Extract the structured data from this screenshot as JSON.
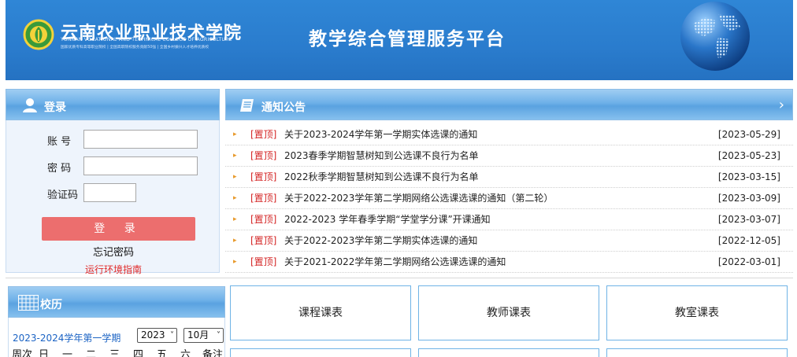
{
  "header": {
    "school_name": "云南农业职业技术学院",
    "school_name_en": "YUNNAN VOCATIONAL AND TECHNICAL COLLEGE OF AGRICULTURE",
    "school_tagline": "国家优质专科高等职业院校 | 全国高职院校服务贡献50强 | 全国乡村振兴人才培养优质校",
    "platform_title": "教学综合管理服务平台"
  },
  "login": {
    "title": "登录",
    "account_label": "账 号",
    "password_label": "密 码",
    "captcha_label": "验证码",
    "account_value": "",
    "password_value": "",
    "captcha_value": "",
    "submit_label": "登 录",
    "forgot_label": "忘记密码",
    "runtime_guide_label": "运行环境指南"
  },
  "notice": {
    "title": "通知公告",
    "items": [
      {
        "tag": "[置顶]",
        "title": "关于2023-2024学年第一学期实体选课的通知",
        "date": "[2023-05-29]"
      },
      {
        "tag": "[置顶]",
        "title": "2023春季学期智慧树知到公选课不良行为名单",
        "date": "[2023-05-23]"
      },
      {
        "tag": "[置顶]",
        "title": "2022秋季学期智慧树知到公选课不良行为名单",
        "date": "[2023-03-15]"
      },
      {
        "tag": "[置顶]",
        "title": "关于2022-2023学年第二学期网络公选课选课的通知（第二轮）",
        "date": "[2023-03-09]"
      },
      {
        "tag": "[置顶]",
        "title": "2022-2023 学年春季学期“学堂学分课”开课通知",
        "date": "[2023-03-07]"
      },
      {
        "tag": "[置顶]",
        "title": "关于2022-2023学年第二学期实体选课的通知",
        "date": "[2022-12-05]"
      },
      {
        "tag": "[置顶]",
        "title": "关于2021-2022学年第二学期网络公选课选课的通知",
        "date": "[2022-03-01]"
      }
    ]
  },
  "calendar": {
    "title": "校历",
    "semester": "2023-2024学年第一学期",
    "year_value": "2023",
    "month_value": "10月",
    "columns": [
      "周次",
      "日",
      "一",
      "二",
      "三",
      "四",
      "五",
      "六",
      "备注"
    ]
  },
  "schedules": {
    "course_label": "课程课表",
    "teacher_label": "教师课表",
    "classroom_label": "教室课表"
  },
  "colors": {
    "banner": "#2a7ccd",
    "panel_head": "#6db0e8",
    "login_button": "#ec6e6e",
    "pin_tag": "#d42626",
    "runtime_link": "#e12a2a",
    "semester_text": "#1b63c4",
    "tile_border": "#6fb3e6"
  }
}
